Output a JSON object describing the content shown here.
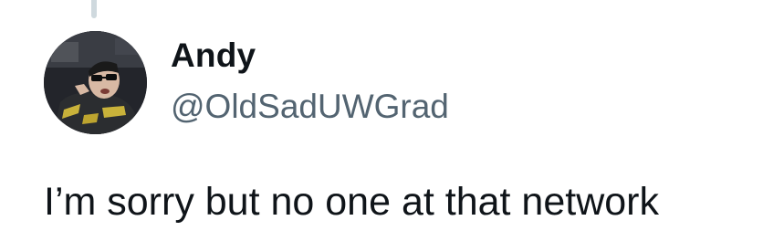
{
  "thread": {
    "connector_color": "#cfd9de"
  },
  "author": {
    "display_name": "Andy",
    "handle": "@OldSadUWGrad",
    "avatar_icon": "profile-photo"
  },
  "tweet": {
    "text": "I’m sorry but no one at that network"
  },
  "colors": {
    "primary_text": "#0f1419",
    "secondary_text": "#536471",
    "background": "#ffffff"
  }
}
